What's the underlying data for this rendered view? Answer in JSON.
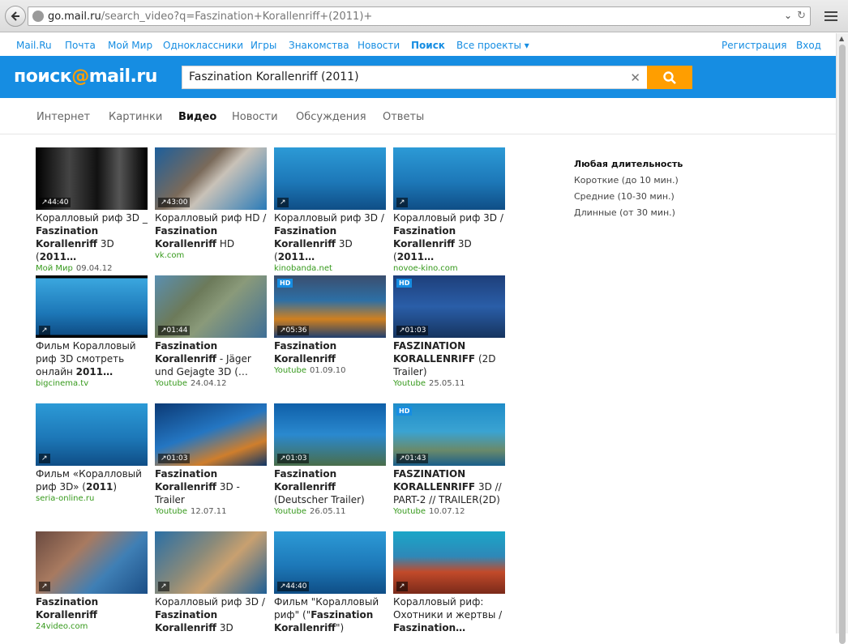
{
  "browser": {
    "url_base": "go.mail.ru",
    "url_path": "/search_video?q=Faszination+Korallenriff+(2011)+"
  },
  "portal_nav": {
    "left": [
      "Mail.Ru",
      "Почта",
      "Мой Мир",
      "Одноклассники",
      "Игры",
      "Знакомства",
      "Новости",
      "Поиск",
      "Все проекты"
    ],
    "right": [
      "Регистрация",
      "Вход"
    ]
  },
  "header": {
    "logo_left": "поиск",
    "logo_at": "@",
    "logo_right": "mail.ru",
    "search_value": "Faszination Korallenriff (2011)"
  },
  "tabs": [
    "Интернет",
    "Картинки",
    "Видео",
    "Новости",
    "Обсуждения",
    "Ответы"
  ],
  "filters": {
    "heading": "Любая длительность",
    "items": [
      "Короткие (до 10 мин.)",
      "Средние (10-30 мин.)",
      "Длинные (от 30 мин.)"
    ]
  },
  "colors": {
    "brand_blue": "#168de2",
    "accent_orange": "#ff9e00",
    "source_green": "#35991b"
  },
  "videos": [
    {
      "title_pre": "Коралловый риф 3D _ ",
      "title_bold": "Faszination Korallenriff",
      "title_post": " 3D (",
      "title_bold2": "2011…",
      "source": "Мой Мир",
      "date": "09.04.12",
      "duration": "44:40",
      "hd": false
    },
    {
      "title_pre": "Коралловый риф HD / ",
      "title_bold": "Faszination Korallenriff",
      "title_post": " HD",
      "title_bold2": "",
      "source": "vk.com",
      "date": "",
      "duration": "43:00",
      "hd": false
    },
    {
      "title_pre": "Коралловый риф 3D / ",
      "title_bold": "Faszination Korallenriff",
      "title_post": " 3D (",
      "title_bold2": "2011…",
      "source": "kinobanda.net",
      "date": "",
      "duration": "",
      "hd": false
    },
    {
      "title_pre": "Коралловый риф 3D / ",
      "title_bold": "Faszination Korallenriff",
      "title_post": " 3D (",
      "title_bold2": "2011…",
      "source": "novoe-kino.com",
      "date": "",
      "duration": "",
      "hd": false
    },
    {
      "title_pre": "Фильм Коралловый риф 3D смотреть онлайн ",
      "title_bold": "2011…",
      "title_post": "",
      "title_bold2": "",
      "source": "bigcinema.tv",
      "date": "",
      "duration": "",
      "hd": false
    },
    {
      "title_pre": "",
      "title_bold": "Faszination Korallenriff",
      "title_post": " - Jäger und Gejagte 3D (…",
      "title_bold2": "",
      "source": "Youtube",
      "date": "24.04.12",
      "duration": "01:44",
      "hd": false
    },
    {
      "title_pre": "",
      "title_bold": "Faszination Korallenriff",
      "title_post": "",
      "title_bold2": "",
      "source": "Youtube",
      "date": "01.09.10",
      "duration": "05:36",
      "hd": true
    },
    {
      "title_pre": "",
      "title_bold": "FASZINATION KORALLENRIFF",
      "title_post": " (2D Trailer)",
      "title_bold2": "",
      "source": "Youtube",
      "date": "25.05.11",
      "duration": "01:03",
      "hd": true
    },
    {
      "title_pre": "Фильм «Коралловый риф 3D» (",
      "title_bold": "2011",
      "title_post": ")",
      "title_bold2": "",
      "source": "seria-online.ru",
      "date": "",
      "duration": "",
      "hd": false
    },
    {
      "title_pre": "",
      "title_bold": "Faszination Korallenriff",
      "title_post": " 3D - Trailer",
      "title_bold2": "",
      "source": "Youtube",
      "date": "12.07.11",
      "duration": "01:03",
      "hd": false
    },
    {
      "title_pre": "",
      "title_bold": "Faszination Korallenriff",
      "title_post": " (Deutscher Trailer)",
      "title_bold2": "",
      "source": "Youtube",
      "date": "26.05.11",
      "duration": "01:03",
      "hd": false
    },
    {
      "title_pre": "",
      "title_bold": "FASZINATION KORALLENRIFF",
      "title_post": " 3D // PART-2 // TRAILER(2D)",
      "title_bold2": "",
      "source": "Youtube",
      "date": "10.07.12",
      "duration": "01:43",
      "hd": true
    },
    {
      "title_pre": "",
      "title_bold": "Faszination Korallenriff",
      "title_post": "",
      "title_bold2": "",
      "source": "24video.com",
      "date": "",
      "duration": "",
      "hd": false
    },
    {
      "title_pre": "Коралловый риф 3D / ",
      "title_bold": "Faszination Korallenriff",
      "title_post": " 3D",
      "title_bold2": "",
      "source": "",
      "date": "",
      "duration": "",
      "hd": false
    },
    {
      "title_pre": "Фильм \"Коралловый риф\" (\"",
      "title_bold": "Faszination Korallenriff",
      "title_post": "\")",
      "title_bold2": "",
      "source": "",
      "date": "",
      "duration": "44:40",
      "hd": false
    },
    {
      "title_pre": "Коралловый риф: Охотники и жертвы / ",
      "title_bold": "Faszination…",
      "title_post": "",
      "title_bold2": "",
      "source": "",
      "date": "",
      "duration": "",
      "hd": false
    }
  ]
}
